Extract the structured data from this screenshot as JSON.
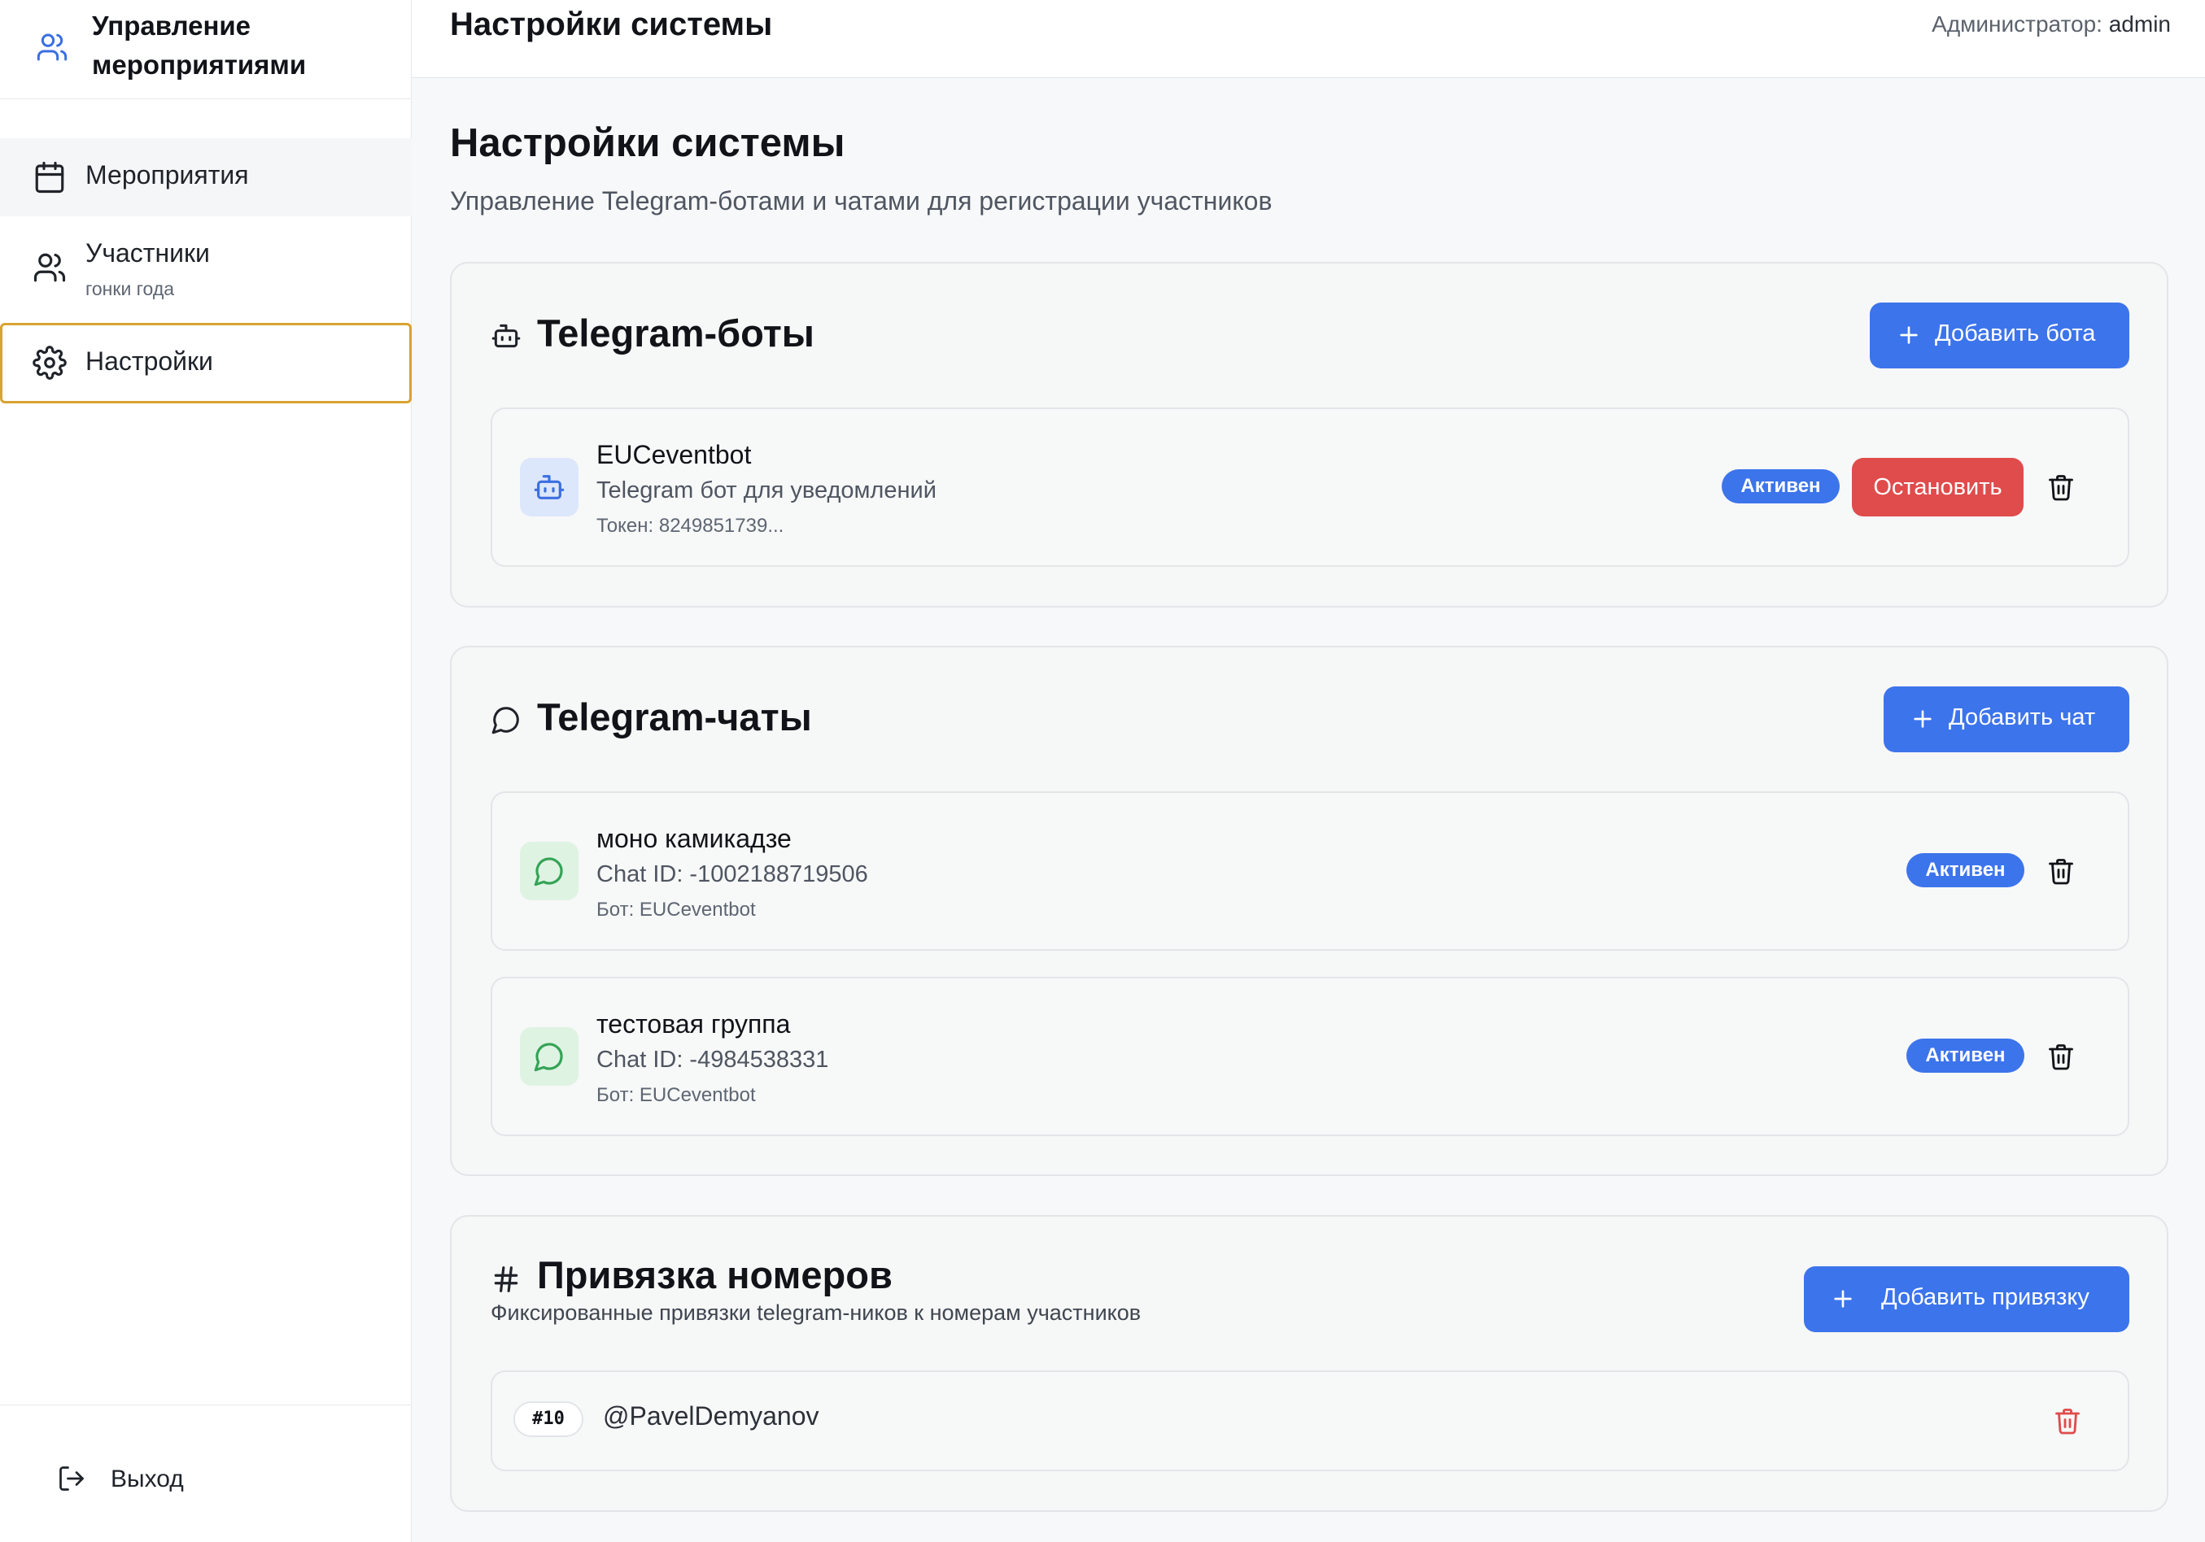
{
  "sidebar": {
    "brand": "Управление мероприятиями",
    "items": [
      {
        "label": "Мероприятия"
      },
      {
        "label": "Участники",
        "sub": "гонки года"
      },
      {
        "label": "Настройки"
      }
    ],
    "logout": "Выход"
  },
  "topbar": {
    "title": "Настройки системы",
    "user_prefix": "Администратор:",
    "user_name": "admin"
  },
  "page": {
    "title": "Настройки системы",
    "subtitle": "Управление Telegram-ботами и чатами для регистрации участников"
  },
  "bots": {
    "title": "Telegram-боты",
    "add_label": "Добавить бота",
    "items": [
      {
        "name": "EUCeventbot",
        "description": "Telegram бот для уведомлений",
        "token": "Токен: 8249851739...",
        "status": "Активен",
        "stop_label": "Остановить"
      }
    ]
  },
  "chats": {
    "title": "Telegram-чаты",
    "add_label": "Добавить чат",
    "items": [
      {
        "name": "моно камикадзе",
        "chat_id": "Chat ID: -1002188719506",
        "bot": "Бот: EUCeventbot",
        "status": "Активен"
      },
      {
        "name": "тестовая группа",
        "chat_id": "Chat ID: -4984538331",
        "bot": "Бот: EUCeventbot",
        "status": "Активен"
      }
    ]
  },
  "bindings": {
    "title": "Привязка номеров",
    "description": "Фиксированные привязки telegram-ников к номерам участников",
    "add_label": "Добавить привязку",
    "items": [
      {
        "number": "#10",
        "handle": "@PavelDemyanov"
      }
    ]
  },
  "colors": {
    "primary": "#3c74eb",
    "danger": "#e04b4b",
    "active_nav_border": "#d9a330"
  },
  "icons": {
    "brand": "users-icon",
    "events": "calendar-icon",
    "participants": "users-icon",
    "settings": "gear-icon",
    "logout": "log-out-icon",
    "bots": "bot-icon",
    "chats": "message-circle-icon",
    "bindings": "hash-icon",
    "add": "plus-icon",
    "delete": "trash-icon"
  }
}
